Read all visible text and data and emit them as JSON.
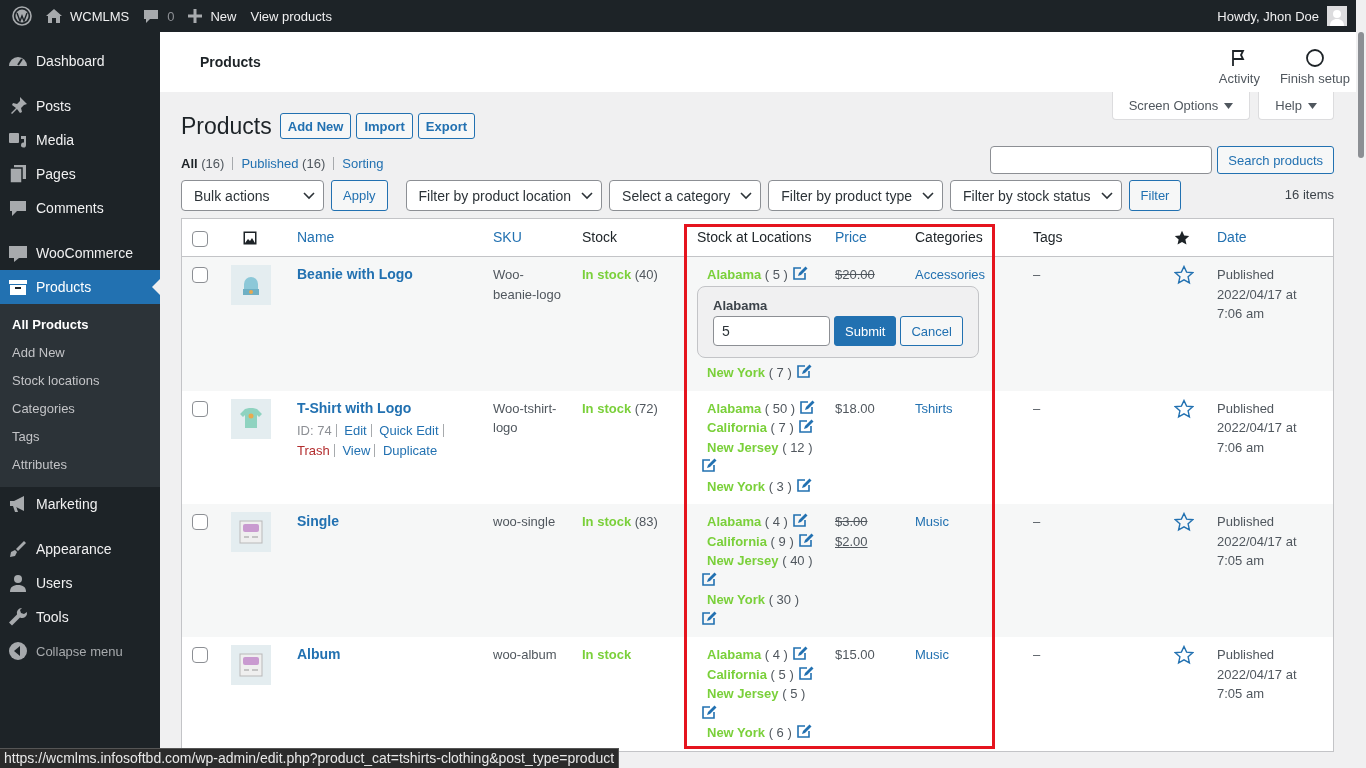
{
  "admin_bar": {
    "site_name": "WCMLMS",
    "comments_count": "0",
    "new_label": "New",
    "view_label": "View products",
    "greeting": "Howdy, Jhon Doe"
  },
  "sidebar": {
    "groups": [
      [
        {
          "label": "Dashboard",
          "selected": false
        }
      ],
      [
        {
          "label": "Posts",
          "selected": false
        },
        {
          "label": "Media",
          "selected": false
        },
        {
          "label": "Pages",
          "selected": false
        },
        {
          "label": "Comments",
          "selected": false
        }
      ],
      [
        {
          "label": "WooCommerce",
          "selected": false
        },
        {
          "label": "Products",
          "selected": true,
          "children": [
            {
              "label": "All Products",
              "selected": true
            },
            {
              "label": "Add New",
              "selected": false
            },
            {
              "label": "Stock locations",
              "selected": false
            },
            {
              "label": "Categories",
              "selected": false
            },
            {
              "label": "Tags",
              "selected": false
            },
            {
              "label": "Attributes",
              "selected": false
            }
          ]
        },
        {
          "label": "Marketing",
          "selected": false
        }
      ],
      [
        {
          "label": "Appearance",
          "selected": false
        },
        {
          "label": "Users",
          "selected": false
        },
        {
          "label": "Tools",
          "selected": false
        }
      ]
    ],
    "collapse_label": "Collapse menu"
  },
  "header_bar": {
    "title": "Products",
    "actions": [
      {
        "label": "Activity",
        "kind": "flag"
      },
      {
        "label": "Finish setup",
        "kind": "circle"
      }
    ]
  },
  "screen_tabs": [
    "Screen Options",
    "Help"
  ],
  "page": {
    "title": "Products",
    "title_actions": [
      "Add New",
      "Import",
      "Export"
    ],
    "views": [
      {
        "label": "All",
        "count": "(16)",
        "selected": true
      },
      {
        "label": "Published",
        "count": "(16)",
        "selected": false
      },
      {
        "label": "Sorting",
        "selected": false
      }
    ],
    "search": {
      "button": "Search products"
    },
    "bulk_actions": {
      "value": "Bulk actions",
      "button": "Apply"
    },
    "filters": [
      "Filter by product location",
      "Select a category",
      "Filter by product type",
      "Filter by stock status"
    ],
    "filter_button": "Filter",
    "item_count": "16 items"
  },
  "table": {
    "columns": [
      {
        "kind": "checkbox",
        "checked": false
      },
      {
        "kind": "image"
      },
      {
        "kind": "text",
        "label": "Name",
        "sortable": true
      },
      {
        "kind": "text",
        "label": "SKU",
        "sortable": true
      },
      {
        "kind": "text",
        "label": "Stock",
        "sortable": false
      },
      {
        "kind": "text",
        "label": "Stock at Locations",
        "sortable": false
      },
      {
        "kind": "text",
        "label": "Price",
        "sortable": true
      },
      {
        "kind": "text",
        "label": "Categories",
        "sortable": false
      },
      {
        "kind": "text",
        "label": "Tags",
        "sortable": false
      },
      {
        "kind": "star"
      },
      {
        "kind": "text",
        "label": "Date",
        "sortable": true
      }
    ],
    "rows": [
      {
        "checked": false,
        "name": "Beanie with Logo",
        "sku": "Woo-beanie-logo",
        "stock_status": "In stock",
        "stock_count": "(40)",
        "locations": [
          {
            "name": "Alabama",
            "count": "( 5 )"
          },
          {
            "name": "New York",
            "count": "( 7 )"
          }
        ],
        "location_editor": {
          "label": "Alabama",
          "value": "5",
          "buttons": [
            "Submit",
            "Cancel"
          ]
        },
        "price": [
          {
            "text": "$20.00",
            "kind": "old"
          }
        ],
        "category": "Accessories",
        "tags": "–",
        "featured": false,
        "date": "Published 2022/04/17 at 7:06 am"
      },
      {
        "checked": false,
        "name": "T-Shirt with Logo",
        "row_actions": [
          {
            "label": "ID: 74",
            "kind": "id"
          },
          {
            "label": "Edit",
            "kind": "link"
          },
          {
            "label": "Quick Edit",
            "kind": "link"
          },
          {
            "label": "Trash",
            "kind": "delete"
          },
          {
            "label": "View",
            "kind": "link"
          },
          {
            "label": "Duplicate",
            "kind": "link"
          }
        ],
        "sku": "Woo-tshirt-logo",
        "stock_status": "In stock",
        "stock_count": "(72)",
        "locations": [
          {
            "name": "Alabama",
            "count": "( 50 )"
          },
          {
            "name": "California",
            "count": "( 7 )"
          },
          {
            "name": "New Jersey",
            "count": "( 12 )"
          },
          {
            "name": "New York",
            "count": "( 3 )"
          }
        ],
        "price": [
          {
            "text": "$18.00",
            "kind": "regular"
          }
        ],
        "category": "Tshirts",
        "tags": "–",
        "featured": false,
        "date": "Published 2022/04/17 at 7:06 am"
      },
      {
        "checked": false,
        "name": "Single",
        "sku": "woo-single",
        "stock_status": "In stock",
        "stock_count": "(83)",
        "locations": [
          {
            "name": "Alabama",
            "count": "( 4 )"
          },
          {
            "name": "California",
            "count": "( 9 )"
          },
          {
            "name": "New Jersey",
            "count": "( 40 )"
          },
          {
            "name": "New York",
            "count": "( 30 )"
          }
        ],
        "price": [
          {
            "text": "$3.00",
            "kind": "old"
          },
          {
            "text": "$2.00",
            "kind": "sale"
          }
        ],
        "category": "Music",
        "tags": "–",
        "featured": false,
        "date": "Published 2022/04/17 at 7:05 am"
      },
      {
        "checked": false,
        "name": "Album",
        "sku": "woo-album",
        "stock_status": "In stock",
        "locations": [
          {
            "name": "Alabama",
            "count": "( 4 )"
          },
          {
            "name": "California",
            "count": "( 5 )"
          },
          {
            "name": "New Jersey",
            "count": "( 5 )"
          },
          {
            "name": "New York",
            "count": "( 6 )"
          }
        ],
        "price": [
          {
            "text": "$15.00",
            "kind": "regular"
          }
        ],
        "category": "Music",
        "tags": "–",
        "featured": false,
        "date": "Published 2022/04/17 at 7:05 am"
      }
    ]
  },
  "status_url": "https://wcmlms.infosoftbd.com/wp-admin/edit.php?product_cat=tshirts-clothing&post_type=product"
}
